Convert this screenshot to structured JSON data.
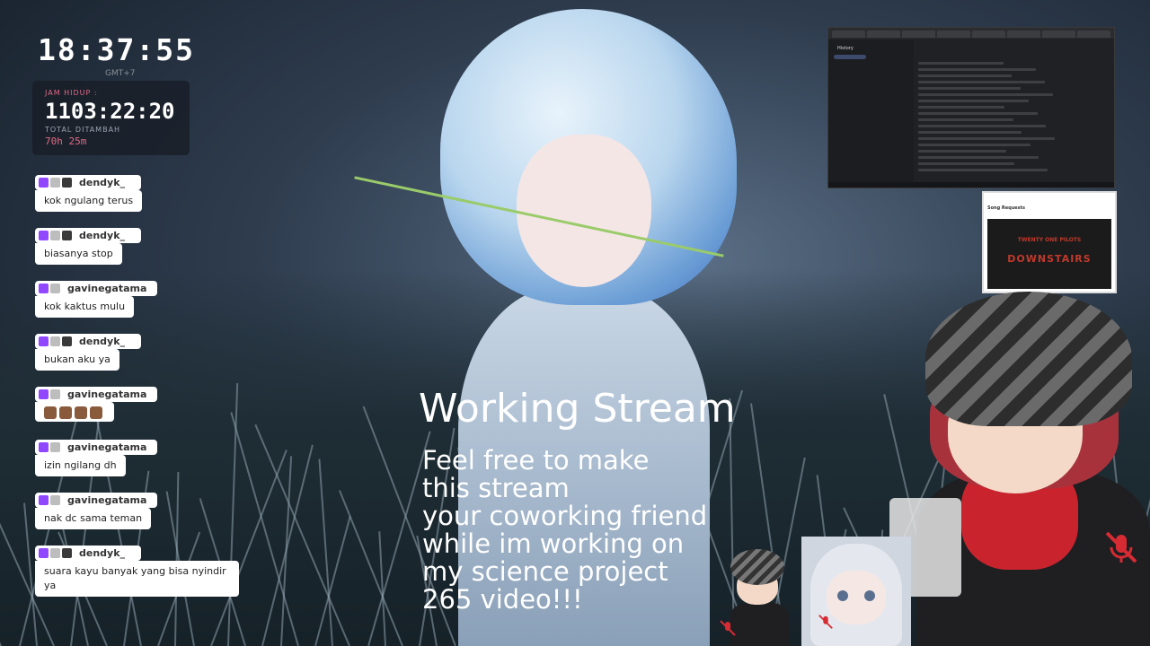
{
  "clock": {
    "time": "18:37:55",
    "timezone": "GMT+7"
  },
  "uptime": {
    "label": "JAM HIDUP :",
    "value": "1103:22:20",
    "added_label": "TOTAL DITAMBAH",
    "added_value": "70h 25m"
  },
  "chat": {
    "messages": [
      {
        "user": "dendyk_",
        "text": "kok ngulang terus"
      },
      {
        "user": "dendyk_",
        "text": "biasanya stop"
      },
      {
        "user": "gavinegatama",
        "text": "kok kaktus mulu"
      },
      {
        "user": "dendyk_",
        "text": "bukan aku ya"
      },
      {
        "user": "gavinegatama",
        "text": ""
      },
      {
        "user": "gavinegatama",
        "text": "izin ngilang dh"
      },
      {
        "user": "gavinegatama",
        "text": "nak dc sama teman"
      },
      {
        "user": "dendyk_",
        "text": "suara kayu banyak yang bisa nyindir ya"
      }
    ]
  },
  "stream": {
    "title": "Working Stream",
    "description_lines": [
      "Feel free to make",
      "this stream",
      "your coworking friend",
      "while im working on",
      "my science project",
      "265 video!!!"
    ]
  },
  "browser_history": {
    "title": "History"
  },
  "song_requests": {
    "title": "Song Requests",
    "band": "TWENTY ONE PILOTS",
    "track": "DOWNSTAIRS"
  },
  "colors": {
    "accent": "#e06a86",
    "twitch": "#9146ff",
    "mute": "#d62b33"
  },
  "icons": [
    "twitch-icon",
    "mic-muted-icon"
  ]
}
